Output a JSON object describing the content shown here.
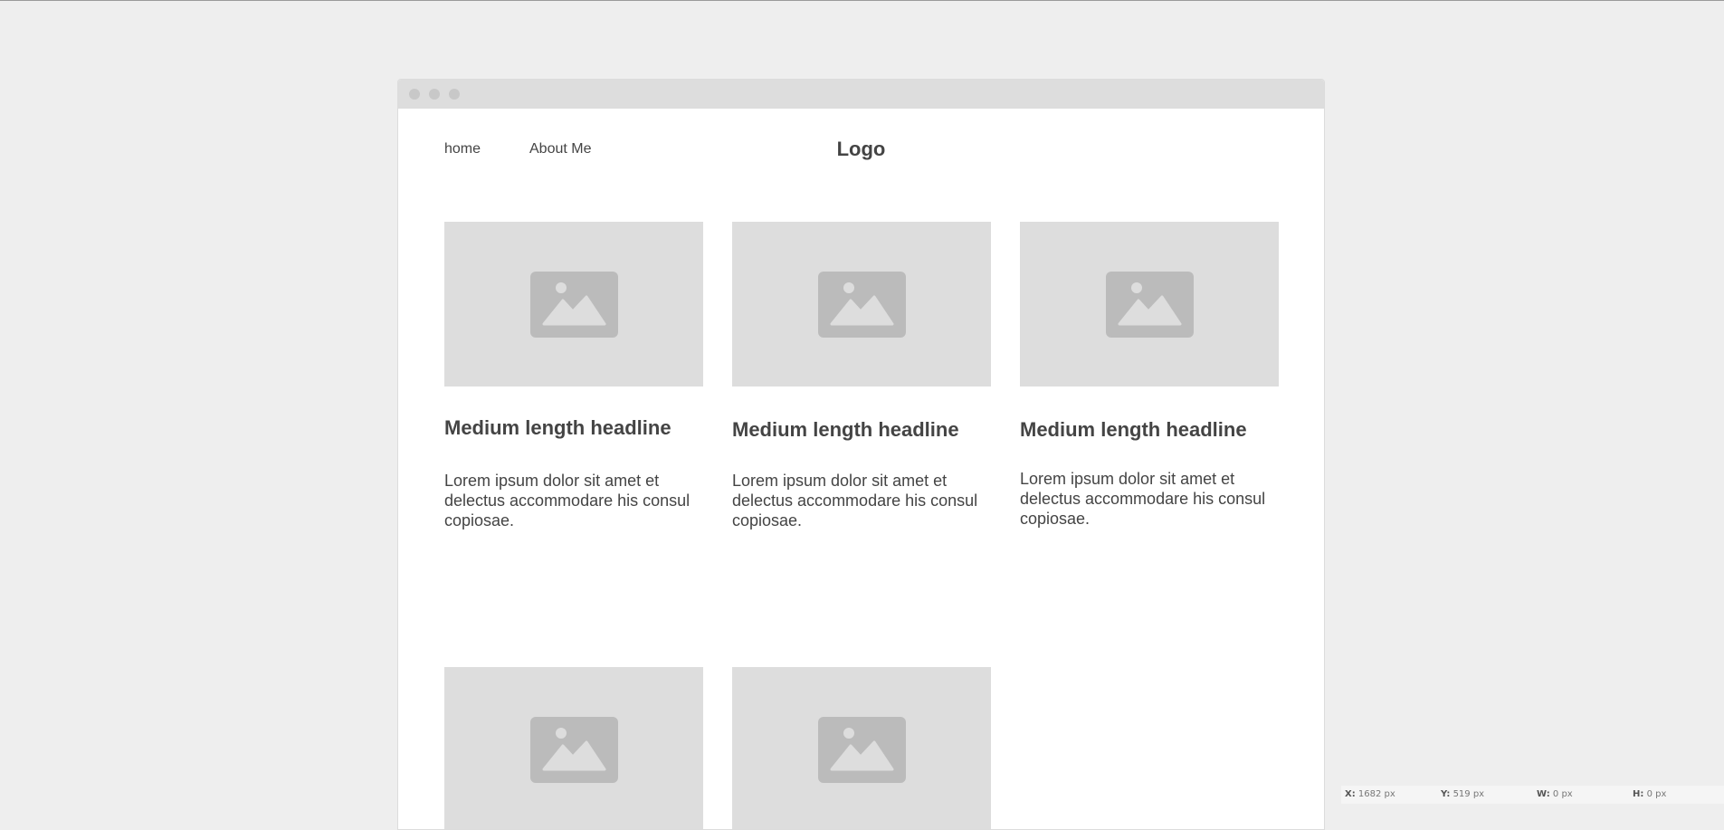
{
  "nav": {
    "home_label": "home",
    "about_label": "About Me",
    "logo_text": "Logo"
  },
  "cards": [
    {
      "headline": "Medium length headline",
      "body": "Lorem ipsum dolor sit amet et delectus accommodare his consul copiosae.",
      "image_icon": "image-placeholder-icon"
    },
    {
      "headline": "Medium length headline",
      "body": "Lorem ipsum dolor sit amet et delectus accommodare his consul copiosae.",
      "image_icon": "image-placeholder-icon"
    },
    {
      "headline": "Medium length headline",
      "body": "Lorem ipsum dolor sit amet et delectus accommodare his consul copiosae.",
      "image_icon": "image-placeholder-icon"
    },
    {
      "image_icon": "image-placeholder-icon"
    },
    {
      "image_icon": "image-placeholder-icon"
    }
  ],
  "status_bar": {
    "x_label": "X:",
    "x_value": "1682 px",
    "y_label": "Y:",
    "y_value": "519 px",
    "w_label": "W:",
    "w_value": "0 px",
    "h_label": "H:",
    "h_value": "0 px"
  },
  "colors": {
    "page_background": "#eeeeee",
    "placeholder": "#dddddd",
    "placeholder_icon": "#bbbbbb",
    "text": "#444444"
  }
}
